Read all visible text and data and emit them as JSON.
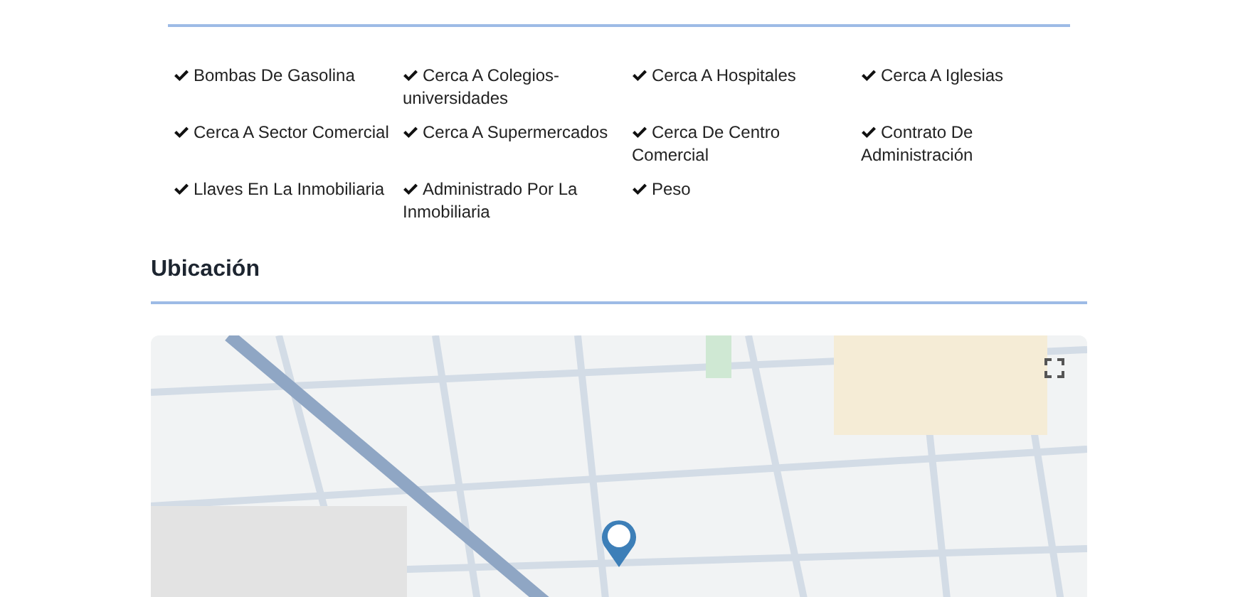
{
  "features": [
    {
      "label": "Bombas De Gasolina"
    },
    {
      "label": "Cerca A Colegios-universidades"
    },
    {
      "label": "Cerca A Hospitales"
    },
    {
      "label": "Cerca A Iglesias"
    },
    {
      "label": "Cerca A Sector Comercial"
    },
    {
      "label": "Cerca A Supermercados"
    },
    {
      "label": "Cerca De Centro Comercial"
    },
    {
      "label": "Contrato De Administración"
    },
    {
      "label": "Llaves En La Inmobiliaria"
    },
    {
      "label": "Administrado Por La Inmobiliaria"
    },
    {
      "label": "Peso"
    }
  ],
  "location": {
    "title": "Ubicación"
  }
}
